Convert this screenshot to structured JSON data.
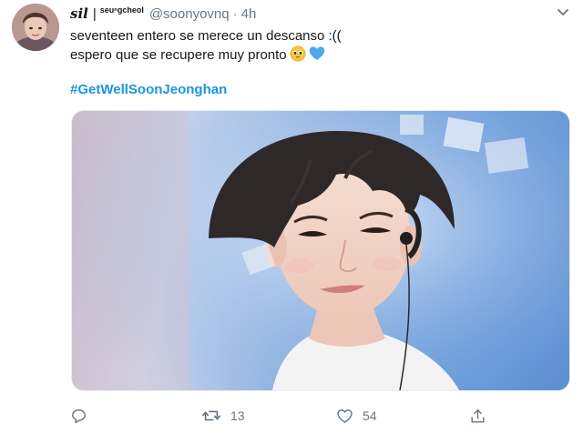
{
  "tweet": {
    "display_name": "sil",
    "name_separator": "|",
    "name_suffix": "seuⁿgcheol",
    "handle": "@soonyovnq",
    "dot": "·",
    "time": "4h",
    "text_lines": [
      "seventeen entero se merece un descanso :((",
      "espero que se recupere muy pronto"
    ],
    "hashtag": "#GetWellSoonJeonghan",
    "actions": {
      "reply_count": "",
      "retweet_count": "13",
      "like_count": "54"
    }
  },
  "icons": {
    "caret": "chevron-down-icon",
    "reply": "reply-icon",
    "retweet": "retweet-icon",
    "like": "heart-icon",
    "share": "share-icon",
    "emoji1": "pleading-face-emoji",
    "emoji2": "blue-heart-emoji"
  },
  "colors": {
    "link": "#1b95e0",
    "secondary_text": "#657786",
    "primary_text": "#14171a",
    "blue_heart": "#4fa8e8",
    "emoji_face": "#f7c53a"
  }
}
